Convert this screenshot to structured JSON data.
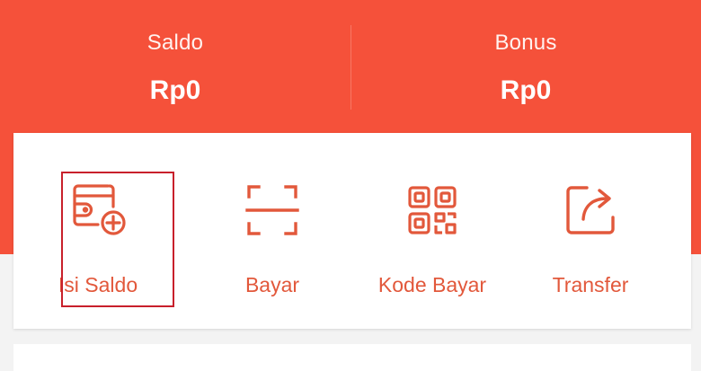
{
  "balances": {
    "saldo": {
      "label": "Saldo",
      "value": "Rp0"
    },
    "bonus": {
      "label": "Bonus",
      "value": "Rp0"
    }
  },
  "actions": [
    {
      "label": "Isi Saldo",
      "icon": "wallet-add-icon"
    },
    {
      "label": "Bayar",
      "icon": "scan-icon"
    },
    {
      "label": "Kode Bayar",
      "icon": "qr-code-icon"
    },
    {
      "label": "Transfer",
      "icon": "share-arrow-icon"
    }
  ],
  "colors": {
    "header": "#f5513a",
    "accent": "#e2583b",
    "highlight_border": "#c8202b",
    "background": "#f3f3f3"
  }
}
